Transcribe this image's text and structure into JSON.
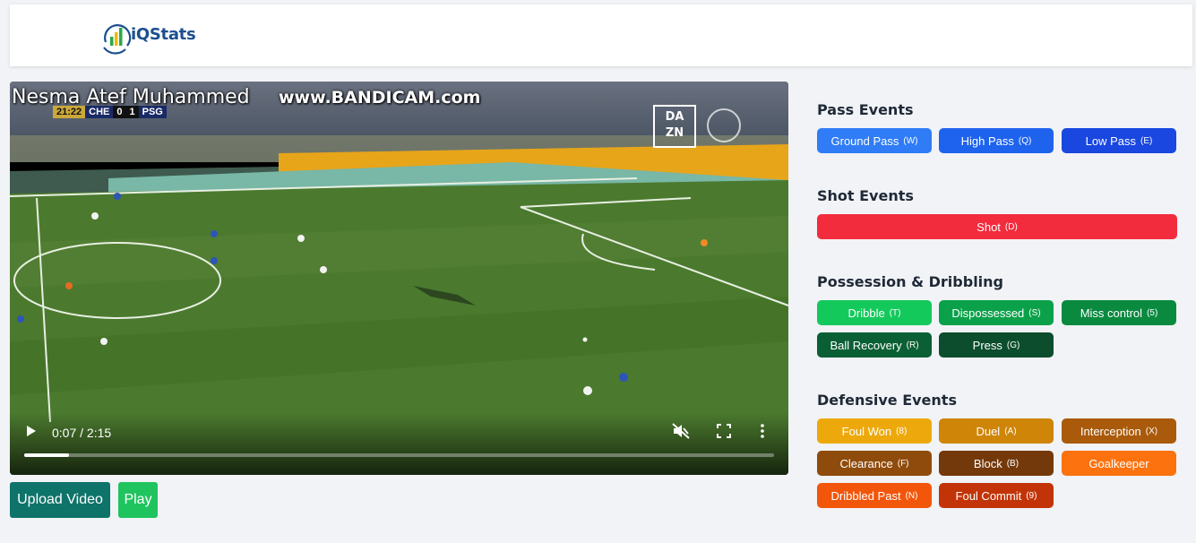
{
  "header": {
    "logo_text": "iQStats",
    "logo_icon": "bar-chart-logo-icon"
  },
  "video": {
    "overlay_name": "Nesma Atef Muhammed",
    "watermark": "www.BANDICAM.com",
    "scorebug": {
      "time": "21:22",
      "home": "CHE",
      "home_score": "0",
      "away_score": "1",
      "away": "PSG"
    },
    "broadcaster": [
      "DA",
      "ZN"
    ],
    "time_display": "0:07 / 2:15",
    "progress_fraction": 0.06
  },
  "actions": {
    "upload_label": "Upload Video",
    "play_label": "Play"
  },
  "sections": {
    "pass": {
      "title": "Pass Events",
      "buttons": [
        {
          "label": "Ground Pass",
          "key": "(W)",
          "color": "#2f7cf6"
        },
        {
          "label": "High Pass",
          "key": "(Q)",
          "color": "#1e63ee"
        },
        {
          "label": "Low Pass",
          "key": "(E)",
          "color": "#1947df"
        }
      ]
    },
    "shot": {
      "title": "Shot Events",
      "buttons": [
        {
          "label": "Shot",
          "key": "(D)",
          "color": "#f22c3d"
        }
      ]
    },
    "possession": {
      "title": "Possession & Dribbling",
      "buttons": [
        {
          "label": "Dribble",
          "key": "(T)",
          "color": "#13c95b"
        },
        {
          "label": "Dispossessed",
          "key": "(S)",
          "color": "#0aa14a"
        },
        {
          "label": "Miss control",
          "key": "(5)",
          "color": "#0a8a3f"
        },
        {
          "label": "Ball Recovery",
          "key": "(R)",
          "color": "#0a5f34"
        },
        {
          "label": "Press",
          "key": "(G)",
          "color": "#0b4d2c"
        }
      ]
    },
    "defensive": {
      "title": "Defensive Events",
      "buttons": [
        {
          "label": "Foul Won",
          "key": "(8)",
          "color": "#eda90c"
        },
        {
          "label": "Duel",
          "key": "(A)",
          "color": "#cf8508"
        },
        {
          "label": "Interception",
          "key": "(X)",
          "color": "#a95a0a"
        },
        {
          "label": "Clearance",
          "key": "(F)",
          "color": "#8f4b0b"
        },
        {
          "label": "Block",
          "key": "(B)",
          "color": "#74390b"
        },
        {
          "label": "Goalkeeper",
          "key": "",
          "color": "#fb720f"
        },
        {
          "label": "Dribbled Past",
          "key": "(N)",
          "color": "#f2560a"
        },
        {
          "label": "Foul Commit",
          "key": "(9)",
          "color": "#c23408"
        }
      ]
    }
  }
}
